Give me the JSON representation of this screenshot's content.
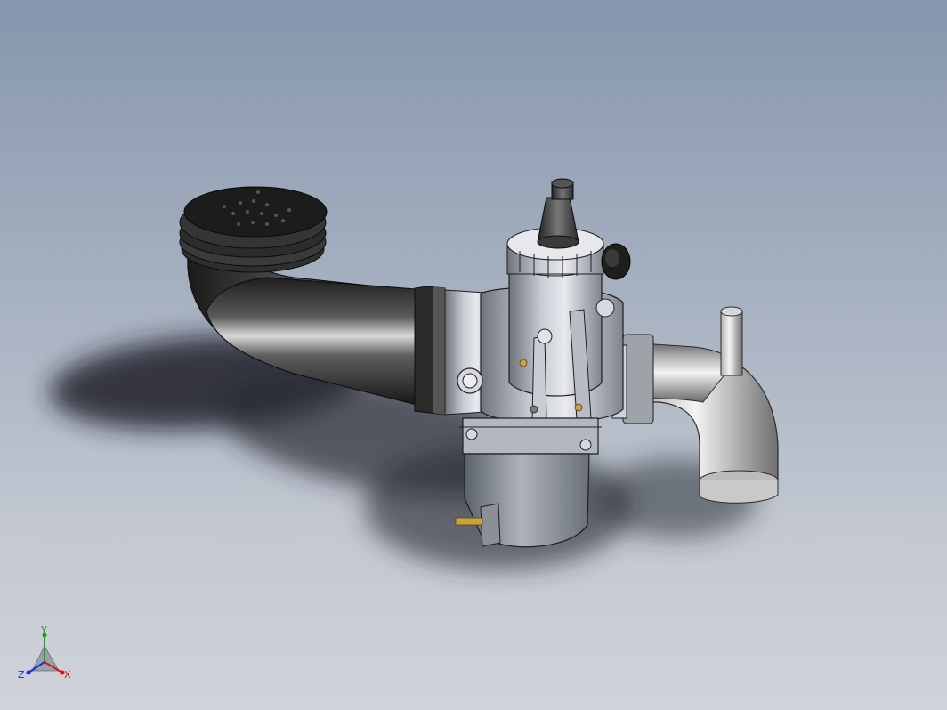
{
  "viewport": {
    "background_top": "#8796ad",
    "background_bottom": "#d0d3d9",
    "model": "carburetor-assembly"
  },
  "triad": {
    "x_label": "X",
    "y_label": "Y",
    "z_label": "Z",
    "x_color": "#d01818",
    "y_color": "#18a018",
    "z_color": "#1830c8"
  }
}
